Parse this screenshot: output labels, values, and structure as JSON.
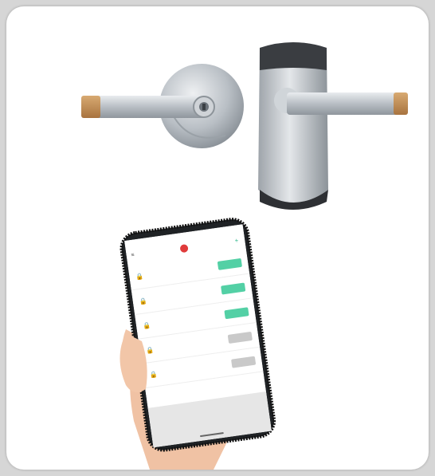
{
  "colors": {
    "accent": "#53d0a5",
    "disabled": "#c9c9c9",
    "brand": "#e03b3b",
    "lever_tip": "#c8955a"
  },
  "icons": [
    "lock-icon",
    "smartphone-icon",
    "hand-icon"
  ]
}
